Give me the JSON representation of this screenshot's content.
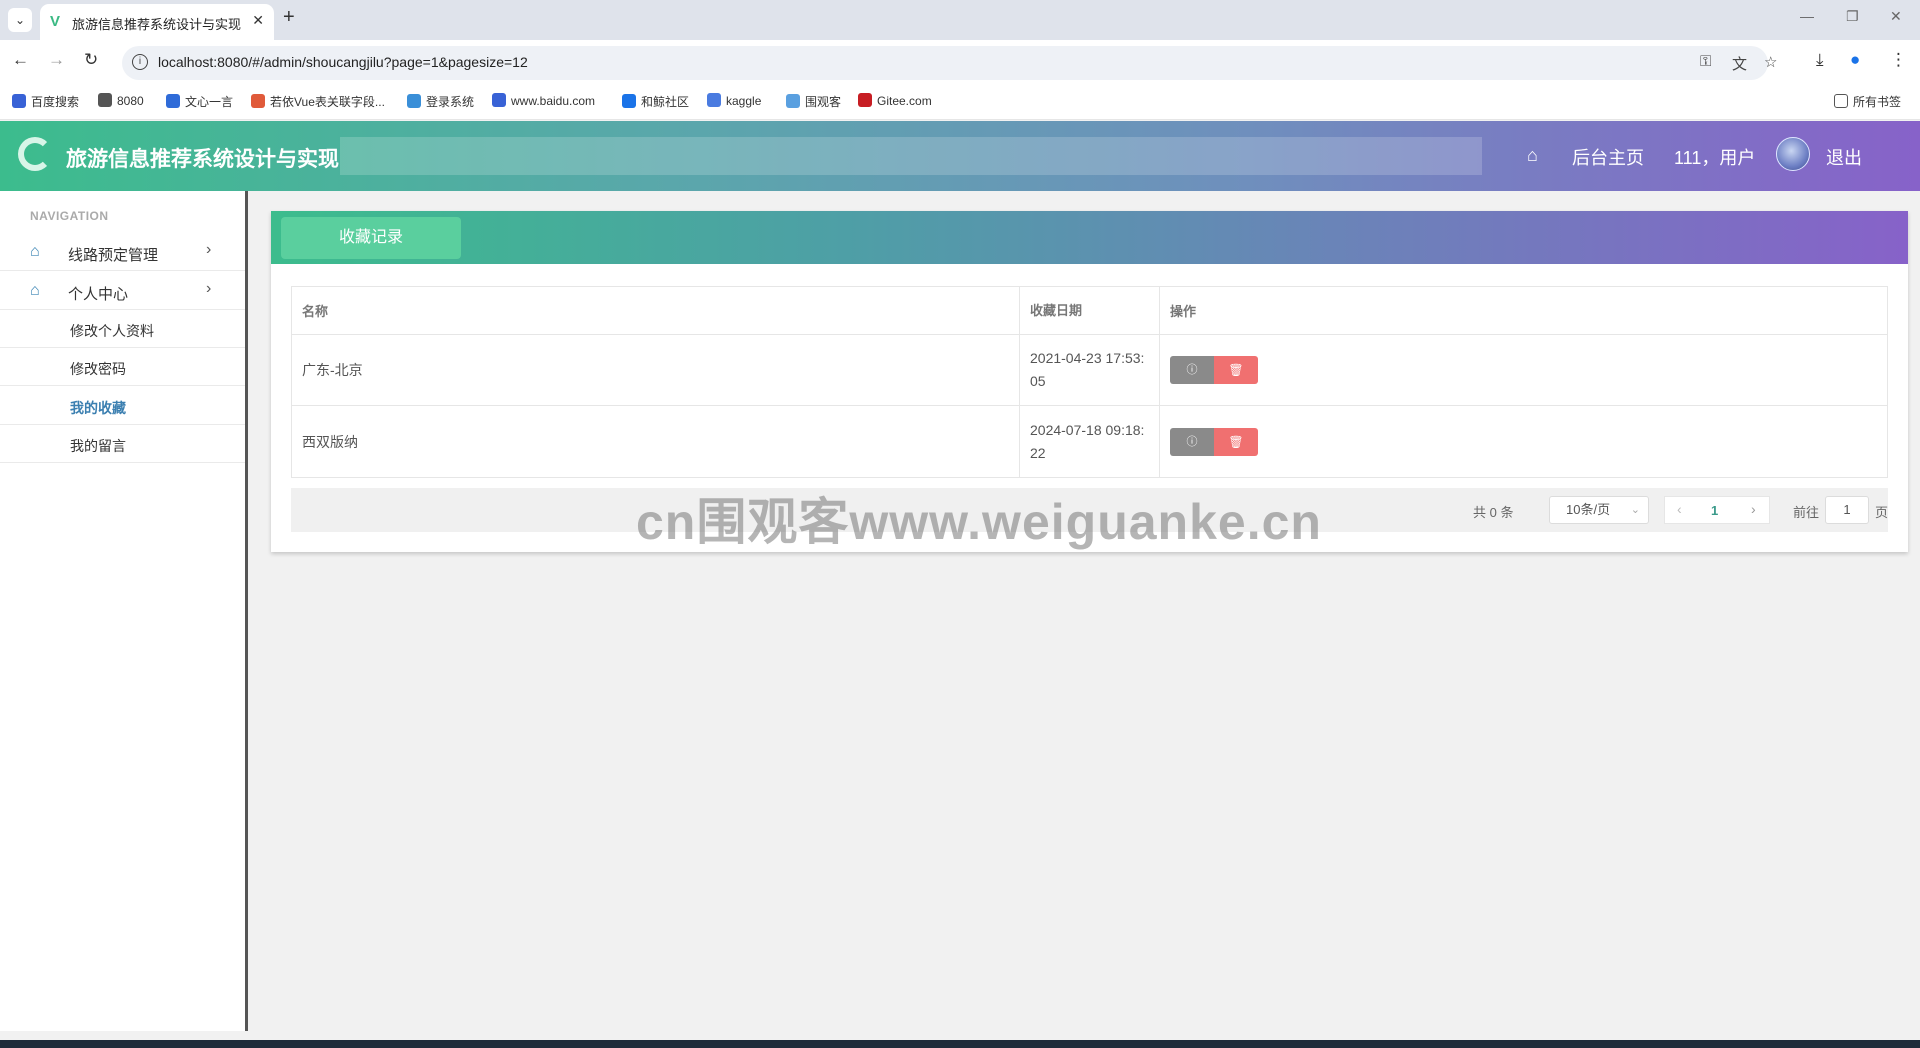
{
  "browser": {
    "tab_title": "旅游信息推荐系统设计与实现",
    "url": "localhost:8080/#/admin/shoucangjilu?page=1&pagesize=12",
    "bookmarks": [
      {
        "label": "百度搜索",
        "color": "#3862d6"
      },
      {
        "label": "8080",
        "color": "#555555"
      },
      {
        "label": "文心一言",
        "color": "#2f6bd8"
      },
      {
        "label": "若依Vue表关联字段...",
        "color": "#e05a3a"
      },
      {
        "label": "登录系统",
        "color": "#3a8fd8"
      },
      {
        "label": "www.baidu.com",
        "color": "#3862d6"
      },
      {
        "label": "和鲸社区",
        "color": "#1a73e8"
      },
      {
        "label": "kaggle",
        "color": "#4a7be0"
      },
      {
        "label": "围观客",
        "color": "#5aa0e0"
      },
      {
        "label": "Gitee.com",
        "color": "#c71d23"
      }
    ],
    "all_bookmarks": "所有书签"
  },
  "header": {
    "title": "旅游信息推荐系统设计与实现",
    "home_link": "后台主页",
    "user_text": "111，用户",
    "logout": "退出"
  },
  "sidebar": {
    "caption": "NAVIGATION",
    "menus": [
      {
        "label": "线路预定管理"
      },
      {
        "label": "个人中心"
      }
    ],
    "sub_items": [
      {
        "label": "修改个人资料"
      },
      {
        "label": "修改密码"
      },
      {
        "label": "我的收藏"
      },
      {
        "label": "我的留言"
      }
    ]
  },
  "content": {
    "tab_label": "收藏记录",
    "columns": [
      "名称",
      "收藏日期",
      "操作"
    ],
    "rows": [
      {
        "name": "广东-北京",
        "date": "2021-04-23 17:53:05"
      },
      {
        "name": "西双版纳",
        "date": "2024-07-18 09:18:22"
      }
    ],
    "pagination": {
      "total": "共 0 条",
      "page_size": "10条/页",
      "current": "1",
      "goto_prefix": "前往",
      "goto_value": "1",
      "goto_suffix": "页"
    }
  },
  "watermark": "cn围观客www.weiguanke.cn",
  "colors": {
    "header_gradient_start": "#3cbc8d",
    "header_gradient_end": "#8762c9",
    "active_menu": "#3b7fb0",
    "delete_button": "#f07070",
    "info_button": "#8a8a8a"
  }
}
